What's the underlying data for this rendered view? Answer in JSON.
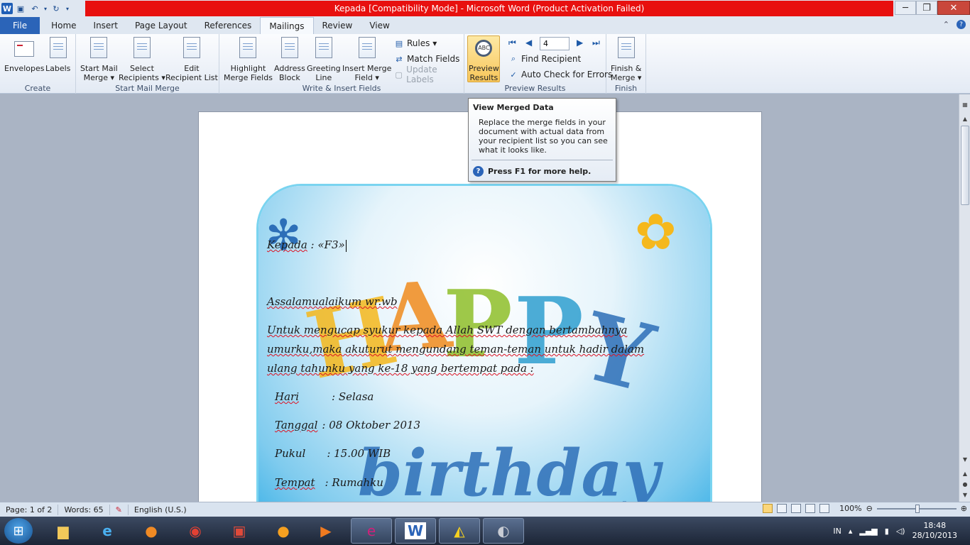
{
  "window": {
    "title": "Kepada [Compatibility Mode]  -  Microsoft Word (Product Activation Failed)",
    "minimize": "─",
    "maximize": "❐",
    "close": "✕"
  },
  "tabs": [
    {
      "label": "File"
    },
    {
      "label": "Home"
    },
    {
      "label": "Insert"
    },
    {
      "label": "Page Layout"
    },
    {
      "label": "References"
    },
    {
      "label": "Mailings"
    },
    {
      "label": "Review"
    },
    {
      "label": "View"
    }
  ],
  "active_tab": "Mailings",
  "ribbon": {
    "create": {
      "label": "Create",
      "envelopes": "Envelopes",
      "labels": "Labels"
    },
    "start_mail_merge": {
      "label": "Start Mail Merge",
      "start_line1": "Start Mail",
      "start_line2": "Merge ▾",
      "select_line1": "Select",
      "select_line2": "Recipients ▾",
      "edit_line1": "Edit",
      "edit_line2": "Recipient List"
    },
    "write_insert": {
      "label": "Write & Insert Fields",
      "highlight_line1": "Highlight",
      "highlight_line2": "Merge Fields",
      "address_line1": "Address",
      "address_line2": "Block",
      "greeting_line1": "Greeting",
      "greeting_line2": "Line",
      "insert_line1": "Insert Merge",
      "insert_line2": "Field ▾",
      "rules": "Rules ▾",
      "match_fields": "Match Fields",
      "update_labels": "Update Labels"
    },
    "preview_results": {
      "label": "Preview Results",
      "preview_line1": "Preview",
      "preview_line2": "Results",
      "record_value": "4",
      "find_recipient": "Find Recipient",
      "auto_check": "Auto Check for Errors"
    },
    "finish": {
      "label": "Finish",
      "finish_line1": "Finish &",
      "finish_line2": "Merge ▾"
    }
  },
  "tooltip": {
    "title": "View Merged Data",
    "body": "Replace the merge fields in your\ndocument with actual data from\nyour recipient list so you can see\nwhat it looks like.",
    "help": "Press F1 for more help."
  },
  "document": {
    "card_word": "HAPPY",
    "card_word2": "birthday",
    "kepada": "Kepada",
    "kepada_value": " : «F3»",
    "greeting": "Assalamualaikum wr.wb",
    "para_line1": "Untuk mengucap syukur kepada Allah SWT dengan bertambahnya",
    "para_line2": "umurku,maka akuturut mengundang teman-teman untuk hadir dalam",
    "para_line3": "ulang tahunku yang ke-18 yang bertempat pada :",
    "hari_label": "Hari",
    "hari_value": ": Selasa",
    "tanggal_label": "Tanggal",
    "tanggal_value": ": 08 Oktober 2013",
    "pukul_label": "Pukul",
    "pukul_value": ": 15.00 WIB",
    "tempat_label": "Tempat",
    "tempat_value": ": Rumahku"
  },
  "status": {
    "page": "Page: 1 of 2",
    "words": "Words: 65",
    "language": "English (U.S.)",
    "zoom": "100%",
    "zoom_level_percent": 100
  },
  "taskbar": {
    "language": "IN",
    "time": "18:48",
    "date": "28/10/2013"
  },
  "colors": {
    "title_red": "#e8100f",
    "file_tab": "#2b64b8",
    "preview_active": "#f8c65a"
  }
}
